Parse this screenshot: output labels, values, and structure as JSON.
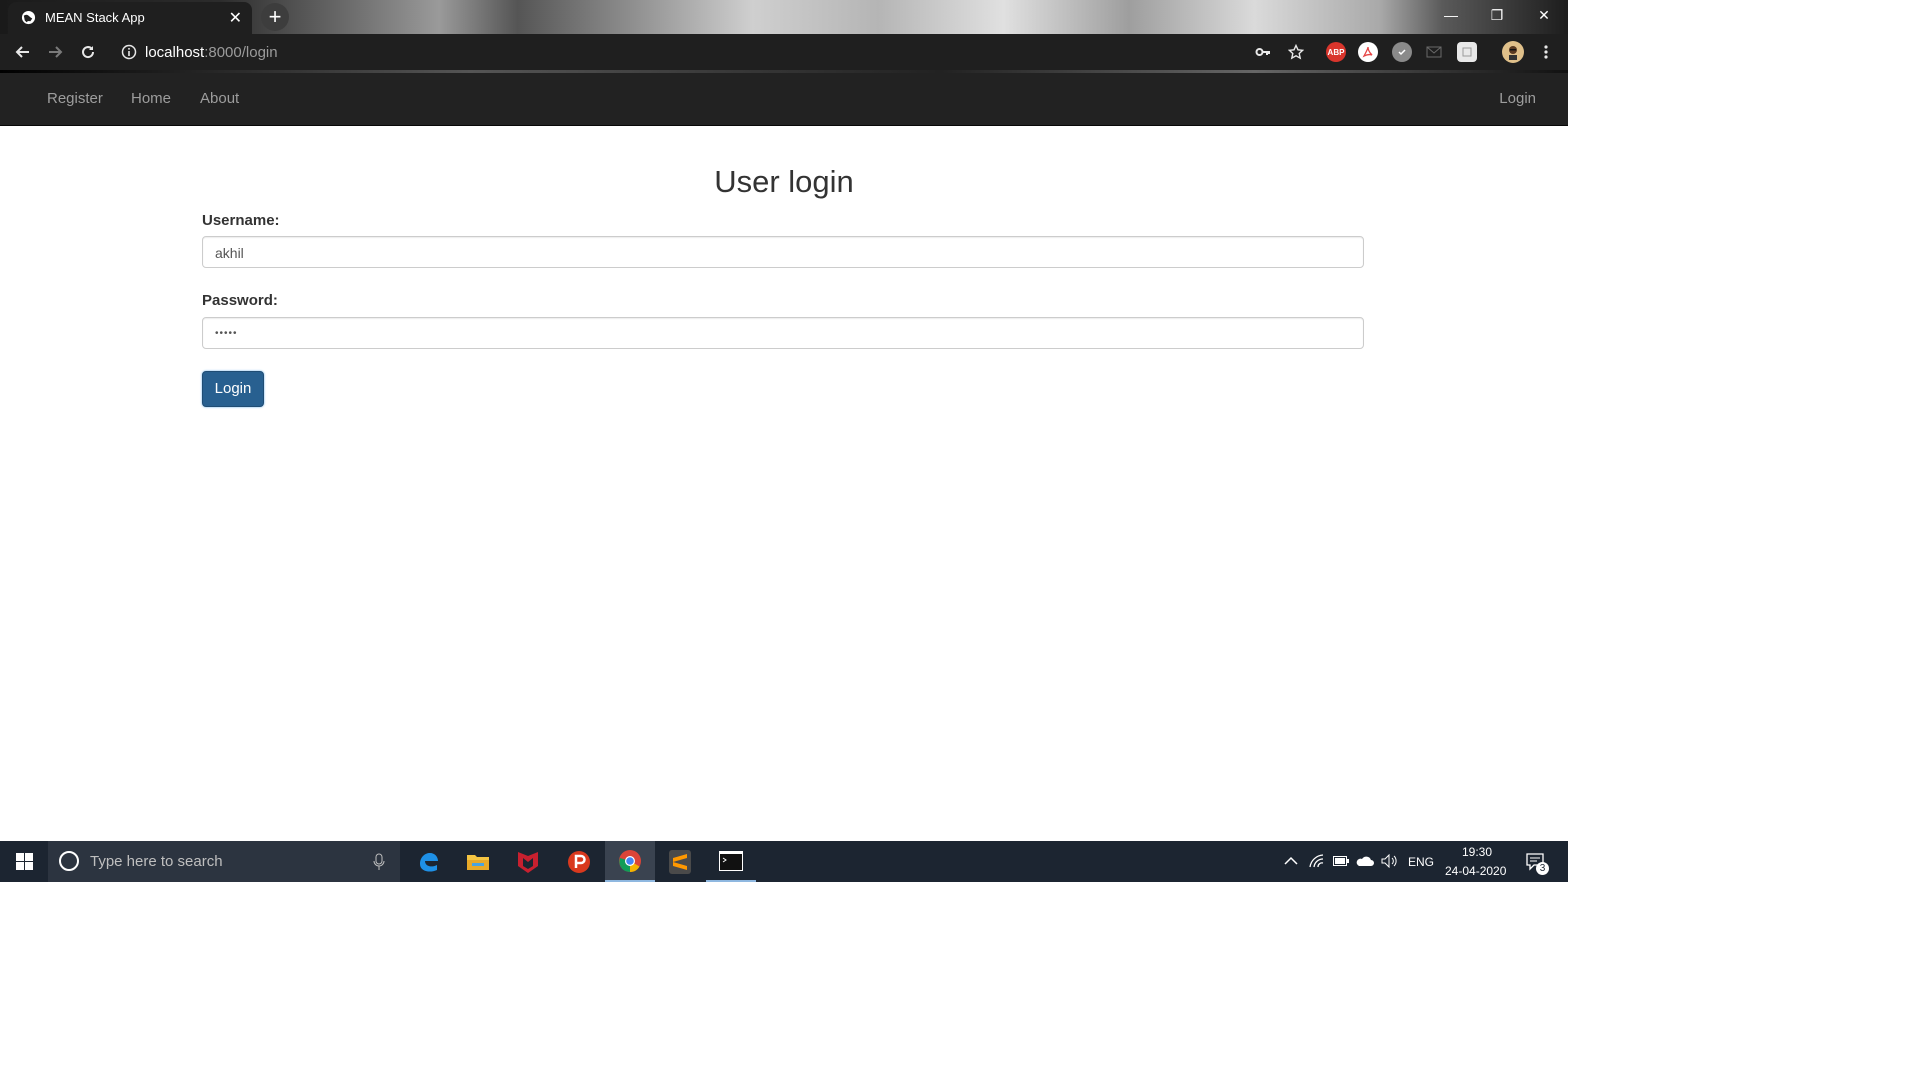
{
  "browser": {
    "tab_title": "MEAN Stack App",
    "tab_close": "✕",
    "new_tab": "+",
    "url_host": "localhost",
    "url_path": ":8000/login",
    "window": {
      "minimize": "—",
      "restore": "❐",
      "close": "✕"
    },
    "extensions": [
      {
        "name": "adblock-plus-icon",
        "label": "ABP",
        "color": "#d9352c"
      },
      {
        "name": "pdf-extension-icon",
        "label": "",
        "color": "#e64545"
      }
    ]
  },
  "navbar": {
    "links": [
      "Register",
      "Home",
      "About"
    ],
    "right_link": "Login",
    "bg_color": "#222222"
  },
  "form": {
    "title": "User login",
    "username_label": "Username:",
    "username_value": "akhil",
    "password_label": "Password:",
    "password_value": "•••••",
    "submit_label": "Login",
    "button_color": "#286090"
  },
  "taskbar": {
    "search_placeholder": "Type here to search",
    "apps": [
      "edge-icon",
      "file-explorer-icon",
      "mcafee-icon",
      "psiphon-icon",
      "chrome-icon",
      "sublime-text-icon",
      "terminal-icon"
    ],
    "language": "ENG",
    "time": "19:30",
    "date": "24-04-2020",
    "notifications": "3"
  }
}
